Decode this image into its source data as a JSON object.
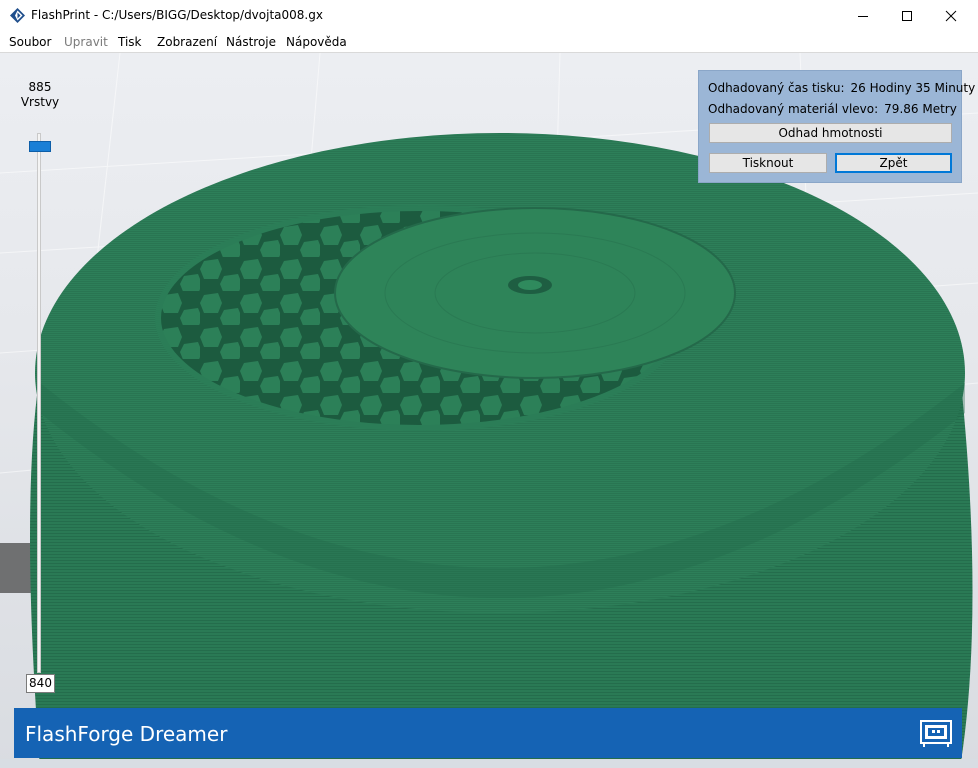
{
  "window": {
    "title": "FlashPrint - C:/Users/BIGG/Desktop/dvojta008.gx",
    "controls": [
      "minimize",
      "maximize",
      "close"
    ]
  },
  "menu": {
    "items": [
      {
        "label": "Soubor",
        "enabled": true
      },
      {
        "label": "Upravit",
        "enabled": false
      },
      {
        "label": "Tisk",
        "enabled": true
      },
      {
        "label": "Zobrazení",
        "enabled": true
      },
      {
        "label": "Nástroje",
        "enabled": true
      },
      {
        "label": "Nápověda",
        "enabled": true
      }
    ]
  },
  "layer_slider": {
    "top_value": "885",
    "unit_label": "Vrstvy",
    "bottom_value": "840"
  },
  "print_info": {
    "time_label": "Odhadovaný čas tisku:",
    "time_value": "26 Hodiny 35 Minuty",
    "material_label": "Odhadovaný materiál vlevo:",
    "material_value": "79.86 Metry",
    "weight_button": "Odhad hmotnosti",
    "print_button": "Tisknout",
    "back_button": "Zpět"
  },
  "device": {
    "name": "FlashForge Dreamer",
    "icon": "printer-icon"
  },
  "colors": {
    "model_green": "#2a7a55",
    "accent_blue": "#1563b4",
    "panel_blue": "#9bb6d6",
    "slider_blue": "#1a7fd6"
  }
}
